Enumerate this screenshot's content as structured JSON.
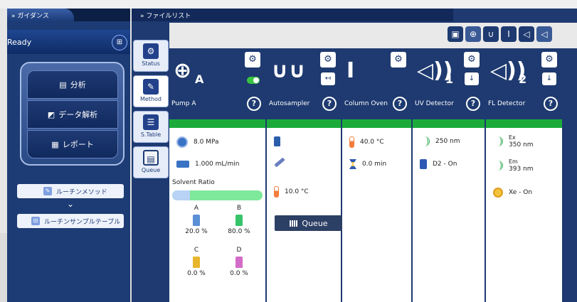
{
  "guidance": {
    "tab_title": "ガイダンス",
    "status": "Ready",
    "flow": [
      {
        "label": "分析",
        "icon": "analysis-icon"
      },
      {
        "label": "データ解析",
        "icon": "data-analysis-icon"
      },
      {
        "label": "レポート",
        "icon": "report-icon"
      }
    ],
    "routine_method": "ルーチンメソッド",
    "routine_sample_table": "ルーチンサンプルテーブル"
  },
  "filelist": {
    "tab_title": "ファイルリスト",
    "side_tabs": [
      {
        "label": "Status",
        "icon": "status-gear-icon"
      },
      {
        "label": "Method",
        "icon": "method-pen-icon"
      },
      {
        "label": "S.Table",
        "icon": "sample-table-icon"
      },
      {
        "label": "Queue",
        "icon": "queue-icon"
      }
    ],
    "toolbar_icons": [
      "monitor-icon",
      "pump-icon",
      "autosampler-icon",
      "column-oven-icon",
      "uv-detector-icon",
      "fl-detector-icon"
    ],
    "modules": {
      "pump": {
        "name": "Pump A",
        "sub": "A",
        "pressure": "8.0 MPa",
        "flow": "1.000 mL/min",
        "solvent_ratio_label": "Solvent Ratio",
        "ratio_a_fraction": 0.2,
        "solvents": [
          {
            "name": "A",
            "value": "20.0 %",
            "color": "#5b8fd6"
          },
          {
            "name": "B",
            "value": "80.0 %",
            "color": "#37c46a"
          },
          {
            "name": "C",
            "value": "0.0 %",
            "color": "#e8b62c"
          },
          {
            "name": "D",
            "value": "0.0 %",
            "color": "#d36bc8"
          }
        ]
      },
      "autosampler": {
        "name": "Autosampler",
        "temperature": "10.0 °C",
        "queue_label": "Queue"
      },
      "column_oven": {
        "name": "Column Oven",
        "temperature": "40.0 °C",
        "time": "0.0 min"
      },
      "uv_detector": {
        "name": "UV Detector",
        "sub": "1",
        "wavelength": "250 nm",
        "lamp": "D2 - On"
      },
      "fl_detector": {
        "name": "FL Detector",
        "sub": "2",
        "ex_label": "Ex",
        "ex_value": "350 nm",
        "em_label": "Em",
        "em_value": "393 nm",
        "lamp": "Xe - On"
      }
    }
  }
}
